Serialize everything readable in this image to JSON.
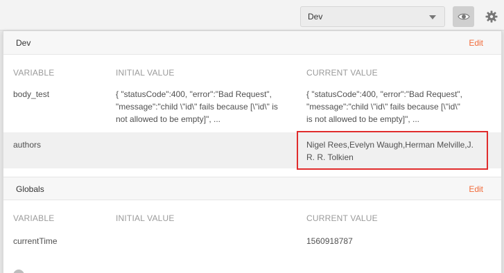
{
  "topbar": {
    "environment": "Dev"
  },
  "sections": [
    {
      "title": "Dev",
      "edit_label": "Edit",
      "columns": [
        "VARIABLE",
        "INITIAL VALUE",
        "CURRENT VALUE"
      ],
      "rows": [
        {
          "variable": "body_test",
          "initial_lines": [
            "{ \"statusCode\":400, \"error\":\"Bad Request\",",
            "\"message\":\"child \\\"id\\\" fails because [\\\"id\\\" is",
            "not allowed to be empty]\", ..."
          ],
          "current_lines": [
            "{ \"statusCode\":400, \"error\":\"Bad Request\",",
            "\"message\":\"child \\\"id\\\" fails because [\\\"id\\\"",
            "is not allowed to be empty]\", ..."
          ]
        },
        {
          "variable": "authors",
          "initial_lines": [],
          "current_lines": [
            "Nigel Rees,Evelyn Waugh,Herman Melville,J.",
            "R. R. Tolkien"
          ]
        }
      ]
    },
    {
      "title": "Globals",
      "edit_label": "Edit",
      "columns": [
        "VARIABLE",
        "INITIAL VALUE",
        "CURRENT VALUE"
      ],
      "rows": [
        {
          "variable": "currentTime",
          "initial_lines": [],
          "current_lines": [
            "1560918787"
          ]
        }
      ]
    }
  ],
  "colors": {
    "accent": "#f26b3a",
    "highlight_border": "#e02b2b"
  },
  "icons": {
    "eye": "eye-icon",
    "gear": "gear-icon",
    "caret": "chevron-down-icon",
    "info": "info-icon"
  }
}
